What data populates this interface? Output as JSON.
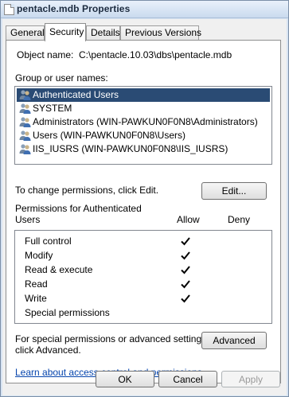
{
  "window": {
    "title": "pentacle.mdb Properties"
  },
  "tabs": [
    {
      "label": "General",
      "active": false
    },
    {
      "label": "Security",
      "active": true
    },
    {
      "label": "Details",
      "active": false
    },
    {
      "label": "Previous Versions",
      "active": false
    }
  ],
  "object": {
    "label": "Object name:",
    "value": "C:\\pentacle.10.03\\dbs\\pentacle.mdb"
  },
  "groups": {
    "label": "Group or user names:",
    "items": [
      {
        "name": "Authenticated Users",
        "selected": true
      },
      {
        "name": "SYSTEM",
        "selected": false
      },
      {
        "name": "Administrators (WIN-PAWKUN0F0N8\\Administrators)",
        "selected": false
      },
      {
        "name": "Users (WIN-PAWKUN0F0N8\\Users)",
        "selected": false
      },
      {
        "name": "IIS_IUSRS (WIN-PAWKUN0F0N8\\IIS_IUSRS)",
        "selected": false
      }
    ]
  },
  "change_text": "To change permissions, click Edit.",
  "edit_button": "Edit...",
  "permissions": {
    "header_line1": "Permissions for Authenticated",
    "header_line2": "Users",
    "allow_label": "Allow",
    "deny_label": "Deny",
    "items": [
      {
        "name": "Full control",
        "allow": true,
        "deny": false
      },
      {
        "name": "Modify",
        "allow": true,
        "deny": false
      },
      {
        "name": "Read & execute",
        "allow": true,
        "deny": false
      },
      {
        "name": "Read",
        "allow": true,
        "deny": false
      },
      {
        "name": "Write",
        "allow": true,
        "deny": false
      },
      {
        "name": "Special permissions",
        "allow": false,
        "deny": false
      }
    ]
  },
  "advanced": {
    "text_line1": "For special permissions or advanced settings,",
    "text_line2": "click Advanced.",
    "button": "Advanced"
  },
  "help_link": "Learn about access control and permissions",
  "footer": {
    "ok": "OK",
    "cancel": "Cancel",
    "apply": "Apply",
    "apply_enabled": false
  },
  "colors": {
    "selection": "#2a4b74",
    "link": "#0645ad",
    "frame": "#d7e4f2"
  }
}
